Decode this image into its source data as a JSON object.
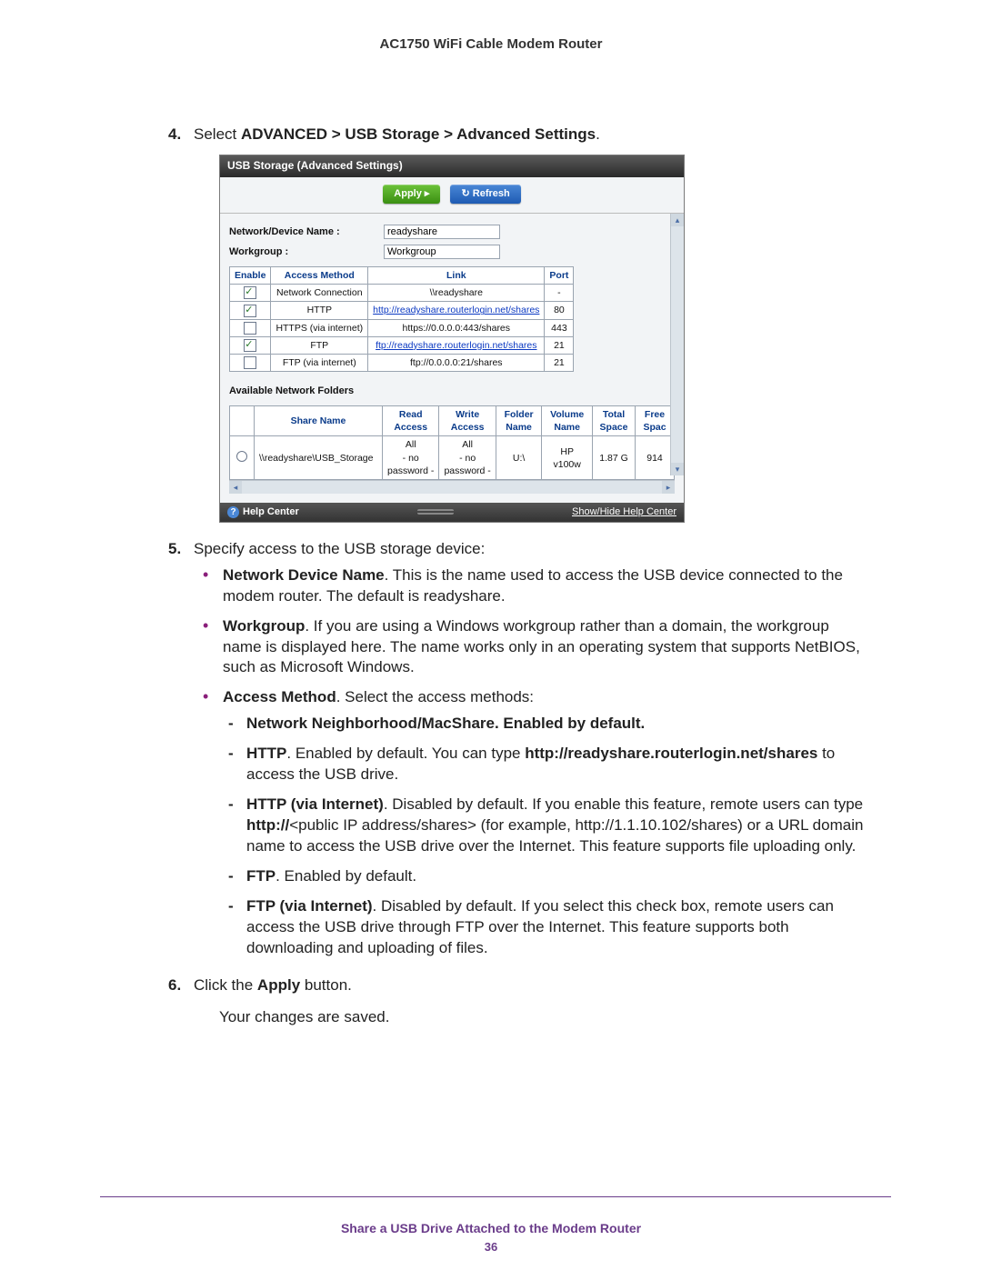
{
  "header": "AC1750 WiFi Cable Modem Router",
  "step4": {
    "prefix": "Select ",
    "bold": "ADVANCED > USB Storage > Advanced Settings",
    "suffix": "."
  },
  "shot": {
    "title": "USB Storage (Advanced Settings)",
    "apply": "Apply ▸",
    "refresh": "↻ Refresh",
    "device_label": "Network/Device Name :",
    "device_value": "readyshare",
    "workgroup_label": "Workgroup :",
    "workgroup_value": "Workgroup",
    "th_enable": "Enable",
    "th_method": "Access Method",
    "th_link": "Link",
    "th_port": "Port",
    "rows": [
      {
        "on": true,
        "method": "Network Connection",
        "link": "\\\\readyshare",
        "port": "-",
        "islink": false
      },
      {
        "on": true,
        "method": "HTTP",
        "link": "http://readyshare.routerlogin.net/shares",
        "port": "80",
        "islink": true
      },
      {
        "on": false,
        "method": "HTTPS (via internet)",
        "link": "https://0.0.0.0:443/shares",
        "port": "443",
        "islink": false
      },
      {
        "on": true,
        "method": "FTP",
        "link": "ftp://readyshare.routerlogin.net/shares",
        "port": "21",
        "islink": true
      },
      {
        "on": false,
        "method": "FTP (via internet)",
        "link": "ftp://0.0.0.0:21/shares",
        "port": "21",
        "islink": false
      }
    ],
    "anf_title": "Available Network Folders",
    "anf_th": {
      "share": "Share Name",
      "read": "Read Access",
      "write": "Write Access",
      "folder": "Folder Name",
      "vol": "Volume Name",
      "total": "Total Space",
      "free": "Free Spac"
    },
    "anf_row": {
      "share": "\\\\readyshare\\USB_Storage",
      "access": "All\n- no password -",
      "folder": "U:\\",
      "vol": "HP v100w",
      "total": "1.87 G",
      "free": "914"
    },
    "help_label": "Help Center",
    "help_showhide": "Show/Hide Help Center"
  },
  "step5": {
    "intro": "Specify access to the USB storage device:",
    "ndn_b": "Network Device Name",
    "ndn_t": ". This is the name used to access the USB device connected to the modem router. The default is readyshare.",
    "wg_b": "Workgroup",
    "wg_t": ". If you are using a Windows workgroup rather than a domain, the workgroup name is displayed here. The name works only in an operating system that supports NetBIOS, such as Microsoft Windows.",
    "am_b": "Access Method",
    "am_t": ". Select the access methods:",
    "d1": "Network Neighborhood/MacShare. Enabled by default.",
    "d2_b": "HTTP",
    "d2_t1": ". Enabled by default. You can type ",
    "d2_b2": "http://readyshare.routerlogin.net/shares",
    "d2_t2": " to access the USB drive.",
    "d3_b": "HTTP (via Internet)",
    "d3_t1": ". Disabled by default. If you enable this feature, remote users can type ",
    "d3_b2": "http://",
    "d3_t2": "<public IP address/shares> (for example, http://1.1.10.102/shares) or a URL domain name to access the USB drive over the Internet. This feature supports file uploading only.",
    "d4_b": "FTP",
    "d4_t": ". Enabled by default.",
    "d5_b": "FTP (via Internet)",
    "d5_t": ". Disabled by default. If you select this check box, remote users can access the USB drive through FTP over the Internet. This feature supports both downloading and uploading of files."
  },
  "step6": {
    "t1": "Click the ",
    "b": "Apply",
    "t2": " button.",
    "saved": "Your changes are saved."
  },
  "footer_text": "Share a USB Drive Attached to the Modem Router",
  "footer_page": "36"
}
